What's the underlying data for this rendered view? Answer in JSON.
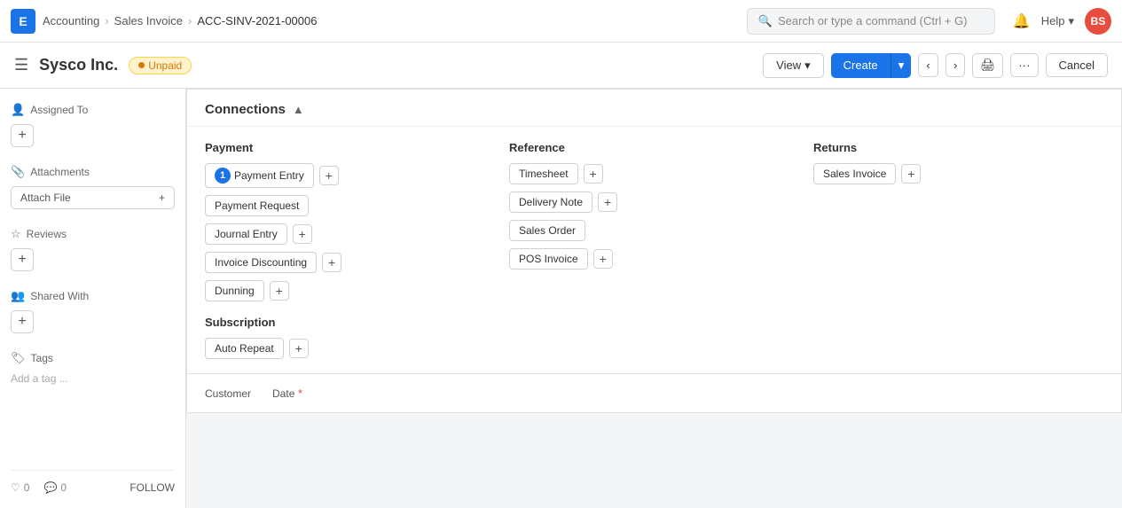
{
  "app": {
    "logo": "E",
    "logo_bg": "#1B73E8"
  },
  "breadcrumb": {
    "items": [
      "Accounting",
      "Sales Invoice",
      "ACC-SINV-2021-00006"
    ]
  },
  "search": {
    "placeholder": "Search or type a command (Ctrl + G)"
  },
  "navbar": {
    "help_label": "Help",
    "avatar_initials": "BS",
    "avatar_bg": "#e74c3c"
  },
  "doc_header": {
    "title": "Sysco Inc.",
    "status": "Unpaid",
    "view_label": "View",
    "create_label": "Create",
    "cancel_label": "Cancel"
  },
  "sidebar": {
    "assigned_to_label": "Assigned To",
    "attachments_label": "Attachments",
    "attach_file_label": "Attach File",
    "reviews_label": "Reviews",
    "shared_with_label": "Shared With",
    "tags_label": "Tags",
    "add_tag_label": "Add a tag ...",
    "likes_count": "0",
    "comments_count": "0",
    "follow_label": "FOLLOW"
  },
  "connections": {
    "title": "Connections",
    "payment_section": "Payment",
    "reference_section": "Reference",
    "returns_section": "Returns",
    "payment_items": [
      {
        "label": "Payment Entry",
        "count": 1,
        "has_count": true,
        "has_plus": true
      },
      {
        "label": "Payment Request",
        "has_count": false,
        "has_plus": false
      },
      {
        "label": "Journal Entry",
        "has_count": false,
        "has_plus": true
      },
      {
        "label": "Invoice Discounting",
        "has_count": false,
        "has_plus": true
      },
      {
        "label": "Dunning",
        "has_count": false,
        "has_plus": true
      }
    ],
    "reference_items": [
      {
        "label": "Timesheet",
        "has_plus": true
      },
      {
        "label": "Delivery Note",
        "has_plus": true
      },
      {
        "label": "Sales Order",
        "has_plus": false
      },
      {
        "label": "POS Invoice",
        "has_plus": true
      }
    ],
    "returns_items": [
      {
        "label": "Sales Invoice",
        "has_plus": true
      }
    ],
    "subscription_section": "Subscription",
    "subscription_items": [
      {
        "label": "Auto Repeat",
        "has_plus": true
      }
    ]
  },
  "customer_section": {
    "customer_label": "Customer",
    "date_label": "Date"
  }
}
